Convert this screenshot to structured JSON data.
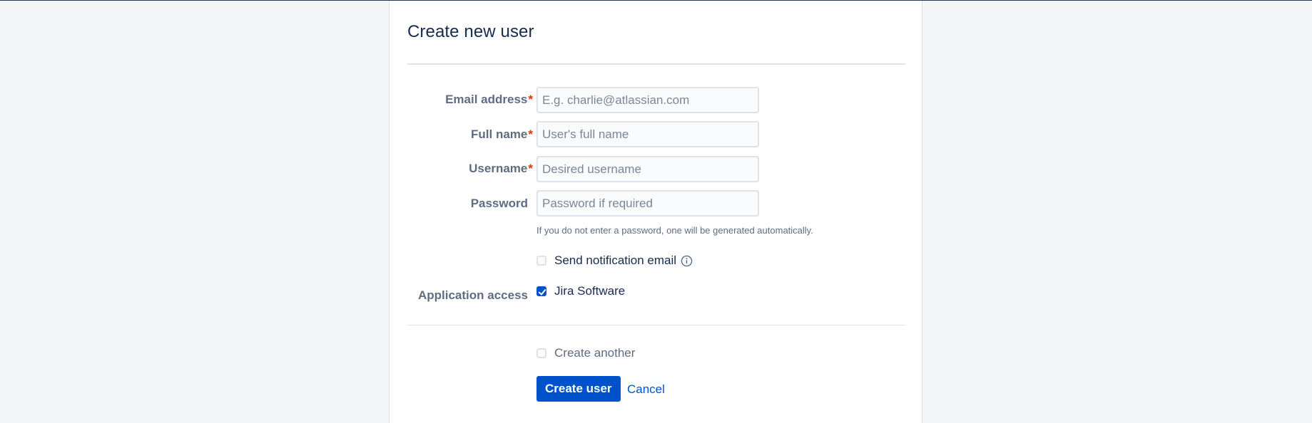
{
  "dialog": {
    "title": "Create new user"
  },
  "form": {
    "email": {
      "label": "Email address",
      "required_mark": "*",
      "value": "",
      "placeholder": "E.g. charlie@atlassian.com"
    },
    "full_name": {
      "label": "Full name",
      "required_mark": "*",
      "value": "",
      "placeholder": "User's full name"
    },
    "username": {
      "label": "Username",
      "required_mark": "*",
      "value": "",
      "placeholder": "Desired username"
    },
    "password": {
      "label": "Password",
      "value": "",
      "placeholder": "Password if required",
      "hint": "If you do not enter a password, one will be generated automatically."
    },
    "send_notification": {
      "label": "Send notification email",
      "checked": false,
      "icon": "info-icon"
    },
    "application_access": {
      "label": "Application access",
      "options": [
        {
          "label": "Jira Software",
          "checked": true
        }
      ]
    }
  },
  "footer": {
    "create_another": {
      "label": "Create another",
      "checked": false
    },
    "submit_label": "Create user",
    "cancel_label": "Cancel"
  },
  "colors": {
    "primary": "#0052cc",
    "required": "#de350b",
    "label": "#5e6c84",
    "text": "#172b4d",
    "page_background": "#f4f5f7"
  }
}
